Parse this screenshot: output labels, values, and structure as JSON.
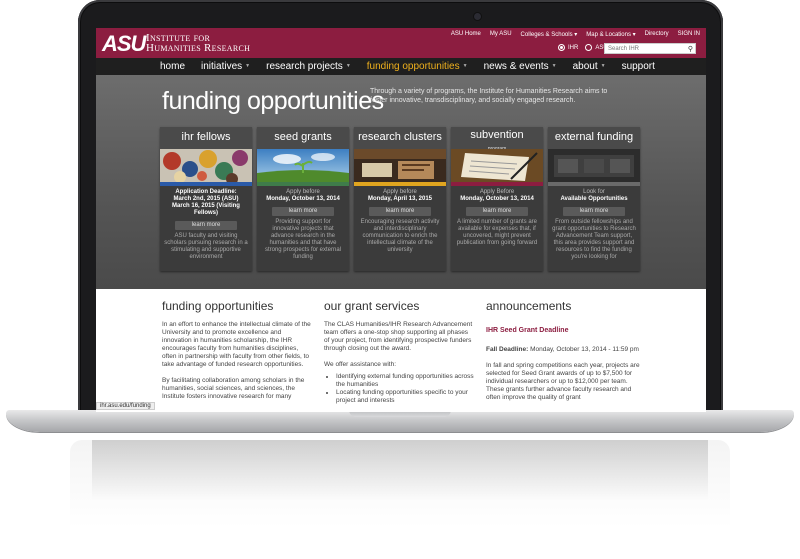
{
  "site": {
    "logo": "ASU",
    "institute_line1": "Institute for",
    "institute_line2": "Humanities Research"
  },
  "top_links": [
    "ASU Home",
    "My ASU",
    "Colleges & Schools ▾",
    "Map & Locations ▾",
    "Directory",
    "SIGN IN"
  ],
  "search": {
    "scope_ihr": "IHR",
    "scope_asu": "ASU",
    "placeholder": "Search IHR"
  },
  "nav": [
    "home",
    "initiatives",
    "research projects",
    "funding opportunities",
    "news & events",
    "about",
    "support"
  ],
  "hero": {
    "title": "funding opportunities",
    "description": "Through a variety of programs, the Institute for Humanities Research aims to foster innovative, transdisciplinary, and socially engaged research."
  },
  "cards": [
    {
      "title": "ihr fellows",
      "sub": "",
      "stripe": "#2a5aa8",
      "deadline_label": "Application Deadline:",
      "deadline": "March 2nd, 2015 (ASU) March 16, 2015 (Visiting Fellows)",
      "learn": "learn more",
      "desc": "ASU faculty and visiting scholars pursuing research in a stimulating and supportive environment"
    },
    {
      "title": "seed grants",
      "sub": "",
      "stripe": "#3f7c4a",
      "deadline_label": "Apply before",
      "deadline": "Monday, October 13, 2014",
      "learn": "learn more",
      "desc": "Providing support for innovative projects that advance research in the humanities and that have strong prospects for external funding"
    },
    {
      "title": "research clusters",
      "sub": "",
      "stripe": "#e0a51f",
      "deadline_label": "Apply before",
      "deadline": "Monday, April 13, 2015",
      "learn": "learn more",
      "desc": "Encouraging research activity and interdisciplinary communication to enrich the intellectual climate of the university"
    },
    {
      "title": "subvention",
      "sub": "program",
      "stripe": "#8c1d40",
      "deadline_label": "Apply Before",
      "deadline": "Monday, October 13, 2014",
      "learn": "learn more",
      "desc": "A limited number of grants are available for expenses that, if uncovered, might prevent publication from going forward"
    },
    {
      "title": "external funding",
      "sub": "",
      "stripe": "#6a6a6a",
      "deadline_label": "Look for",
      "deadline": "Available Opportunities",
      "learn": "learn more",
      "desc": "From outside fellowships and grant opportunities to Research Advancement Team support, this area provides support and resources to find the funding you're looking for"
    }
  ],
  "col1": {
    "title": "funding opportunities",
    "p1": "In an effort to enhance the intellectual climate of the University and to promote excellence and innovation in humanities scholarship, the IHR encourages faculty from humanities disciplines, often in partnership with faculty from other fields, to take advantage of funded research opportunities.",
    "p2": "By facilitating collaboration among scholars in the humanities, social sciences, and sciences, the Institute fosters innovative research for many"
  },
  "col2": {
    "title": "our grant services",
    "p1": "The CLAS Humanities/IHR Research Advancement team offers a one-stop shop supporting all phases of your project, from identifying prospective funders through closing out the award.",
    "p2": "We offer assistance with:",
    "li1": "Identifying external funding opportunities across the humanities",
    "li2": "Locating funding opportunities specific to your project and interests"
  },
  "col3": {
    "title": "announcements",
    "ann_title": "IHR Seed Grant Deadline",
    "fall_label": "Fall Deadline:",
    "fall_value": " Monday, October 13, 2014 - 11:59 pm",
    "p": "In fall and spring competitions each year, projects are selected for Seed Grant awards of up to $7,500 for individual researchers or up to $12,000 per team. These grants further advance faculty research and often improve the quality of grant"
  },
  "status_url": "ihr.asu.edu/funding"
}
